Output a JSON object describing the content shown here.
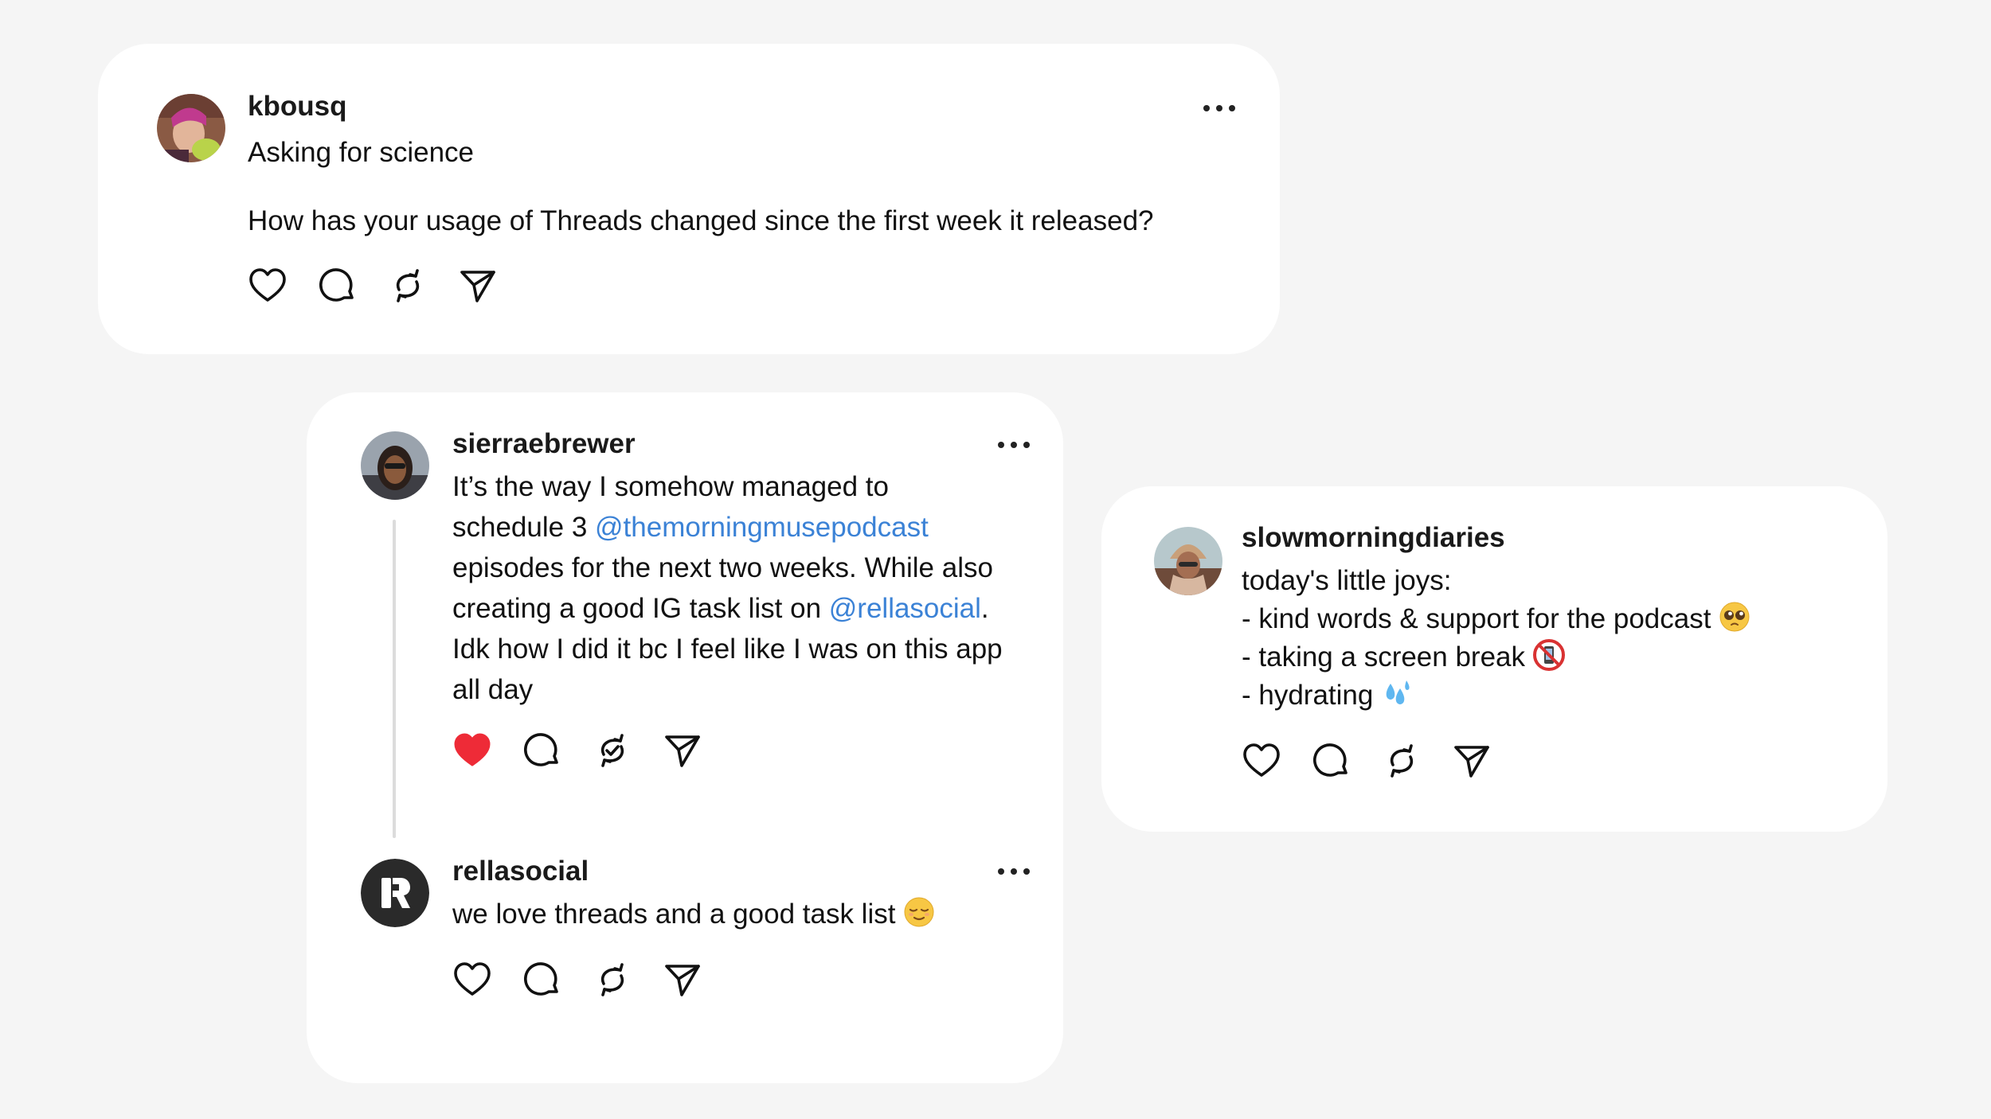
{
  "colors": {
    "background": "#f5f5f5",
    "card": "#ffffff",
    "mention": "#3b82d6",
    "like_active": "#ee2b37"
  },
  "post1": {
    "username": "kbousq",
    "line1": "Asking for science",
    "line2": "How has your usage of Threads changed since the first week it released?",
    "liked": false,
    "icons": [
      "heart-icon",
      "comment-icon",
      "repost-icon",
      "share-icon",
      "more-icon"
    ]
  },
  "post2": {
    "username": "sierraebrewer",
    "text": {
      "l1": "It’s the way I somehow managed to",
      "l2_pre": "schedule 3 ",
      "l2_mention": "@themorningmusepodcast",
      "l3": "episodes for the next two weeks. While also",
      "l4_pre": "creating a good IG task list on ",
      "l4_mention": "@rellasocial",
      "l4_post": ".",
      "l5": "Idk how I did it bc I feel like I was on this app",
      "l6": "all day"
    },
    "liked": true,
    "repost_state": "reposted",
    "icons": [
      "heart-filled-icon",
      "comment-icon",
      "repost-check-icon",
      "share-icon",
      "more-icon"
    ]
  },
  "post3": {
    "username": "rellasocial",
    "text": "we love threads and a good task list",
    "emoji": "relieved-face-emoji",
    "liked": false,
    "icons": [
      "heart-icon",
      "comment-icon",
      "repost-icon",
      "share-icon",
      "more-icon"
    ]
  },
  "post4": {
    "username": "slowmorningdiaries",
    "lines": [
      "today's little joys:",
      "- kind words & support for the podcast",
      "- taking a screen break",
      "- hydrating"
    ],
    "emojis": [
      "pleading-face-emoji",
      "no-mobile-phones-emoji",
      "sweat-droplets-emoji"
    ],
    "liked": false,
    "icons": [
      "heart-icon",
      "comment-icon",
      "repost-icon",
      "share-icon"
    ]
  }
}
